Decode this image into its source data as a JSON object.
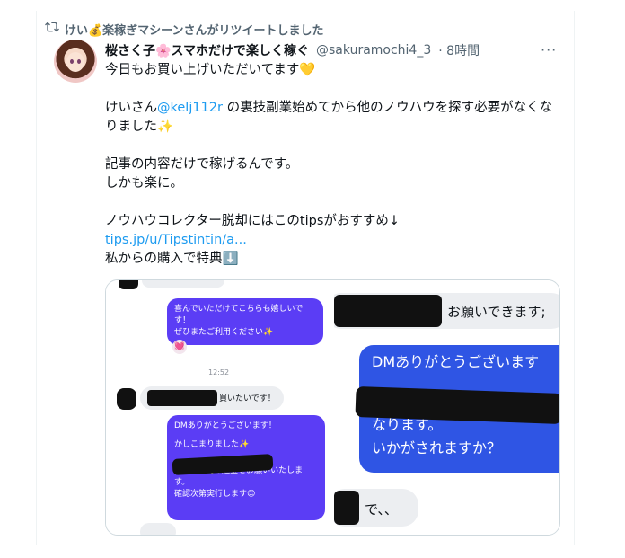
{
  "retweet": {
    "label": "けい💰楽稼ぎマシーンさんがリツイートしました"
  },
  "tweet": {
    "display_name": "桜さく子🌸スマホだけで楽しく稼ぐ",
    "handle": "@sakuramochi4_3",
    "time": "· 8時間",
    "more": "···",
    "lines": {
      "l1": "今日もお買い上げいただいてます💛",
      "l2a": "けいさん",
      "l2mention": "@kelj112r",
      "l2b": " の裏技副業始めてから他のノウハウを探す必要がなくなりました✨",
      "l3": "記事の内容だけで稼げるんです。",
      "l4": "しかも楽に。",
      "l5": "ノウハウコレクター脱却にはこのtipsがおすすめ↓",
      "link": "tips.jp/u/Tipstintin/a...",
      "l6": "私からの購入で特典⬇️"
    }
  },
  "media": {
    "left": {
      "bubble1": "喜んでいただけてこちらも嬉しいです！\nぜひまたご利用ください✨",
      "reaction": "💓",
      "time": "12:52",
      "grey_msg": "買いたいです！",
      "bubble2_l1": "DMありがとうございます！",
      "bubble2_l2": "かしこまりました✨",
      "bubble2_l3": "まで100円の送金をお願いいたします。",
      "bubble2_l4": "確認次第実行します😊"
    },
    "right": {
      "grey_top": "お願いできます;",
      "blue_l1": "DMありがとうございます",
      "blue_l2": "なります。",
      "blue_l3": "いかがされますか？",
      "grey_bottom": "で、、"
    }
  }
}
